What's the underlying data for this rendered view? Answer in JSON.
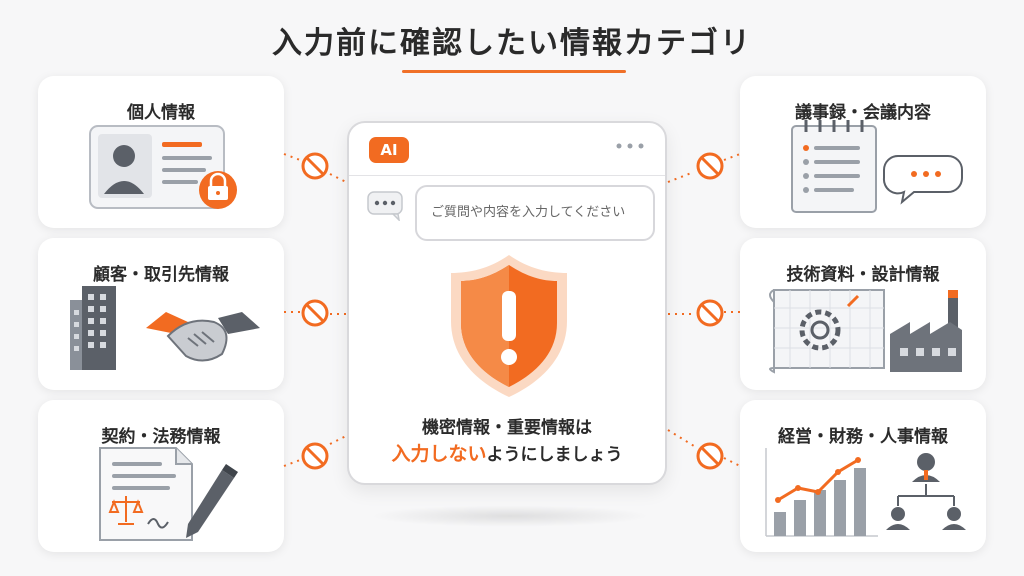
{
  "title": "入力前に確認したい情報カテゴリ",
  "colors": {
    "accent": "#f26b21",
    "prohibit": "#f26b21",
    "card_bg": "#ffffff",
    "background": "#f7f7f8",
    "gray_dark": "#5b6068",
    "gray_mid": "#9aa0a8"
  },
  "categories_left": [
    {
      "label": "個人情報",
      "icon": "id-card-lock-icon"
    },
    {
      "label": "顧客・取引先情報",
      "icon": "building-handshake-icon"
    },
    {
      "label": "契約・法務情報",
      "icon": "contract-pen-icon"
    }
  ],
  "categories_right": [
    {
      "label": "議事録・会議内容",
      "icon": "notepad-chat-icon"
    },
    {
      "label": "技術資料・設計情報",
      "icon": "blueprint-factory-icon"
    },
    {
      "label": "経営・財務・人事情報",
      "icon": "chart-org-icon"
    }
  ],
  "panel": {
    "ai_badge": "AI",
    "input_placeholder": "ご質問や内容を入力してください",
    "warning_line1": "機密情報・重要情報は",
    "warning_accent": "入力しない",
    "warning_rest": "ようにしましょう"
  }
}
